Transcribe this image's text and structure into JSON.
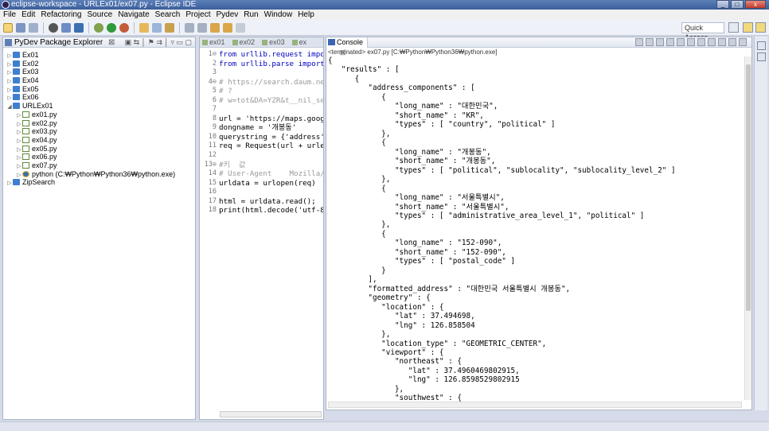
{
  "window": {
    "title": "eclipse-workspace - URLEx01/ex07.py - Eclipse IDE"
  },
  "menu": [
    "File",
    "Edit",
    "Refactoring",
    "Source",
    "Navigate",
    "Search",
    "Project",
    "Pydev",
    "Run",
    "Window",
    "Help"
  ],
  "toolbar": {
    "quick_access": "Quick Access"
  },
  "explorer": {
    "title": "PyDev Package Explorer",
    "items": [
      {
        "label": "Ex01",
        "kind": "project",
        "level": 0,
        "state": "collapsed"
      },
      {
        "label": "Ex02",
        "kind": "project",
        "level": 0,
        "state": "collapsed"
      },
      {
        "label": "Ex03",
        "kind": "project",
        "level": 0,
        "state": "collapsed"
      },
      {
        "label": "Ex04",
        "kind": "project",
        "level": 0,
        "state": "collapsed"
      },
      {
        "label": "Ex05",
        "kind": "project",
        "level": 0,
        "state": "collapsed"
      },
      {
        "label": "Ex06",
        "kind": "project",
        "level": 0,
        "state": "collapsed"
      },
      {
        "label": "URLEx01",
        "kind": "project",
        "level": 0,
        "state": "expanded"
      },
      {
        "label": "ex01.py",
        "kind": "file",
        "level": 1,
        "state": "collapsed"
      },
      {
        "label": "ex02.py",
        "kind": "file",
        "level": 1,
        "state": "collapsed"
      },
      {
        "label": "ex03.py",
        "kind": "file",
        "level": 1,
        "state": "collapsed"
      },
      {
        "label": "ex04.py",
        "kind": "file",
        "level": 1,
        "state": "collapsed"
      },
      {
        "label": "ex05.py",
        "kind": "file",
        "level": 1,
        "state": "collapsed"
      },
      {
        "label": "ex06.py",
        "kind": "file",
        "level": 1,
        "state": "collapsed"
      },
      {
        "label": "ex07.py",
        "kind": "file",
        "level": 1,
        "state": "collapsed"
      },
      {
        "label": "python  (C:₩Python₩Python36₩python.exe)",
        "kind": "python",
        "level": 1,
        "state": "collapsed"
      },
      {
        "label": "ZipSearch",
        "kind": "project",
        "level": 0,
        "state": "collapsed"
      }
    ]
  },
  "editor": {
    "tabs": [
      "ex01",
      "ex02",
      "ex03",
      "ex"
    ],
    "lines": [
      {
        "n": "1⊖",
        "t": "from urllib.request impo",
        "c": "kw"
      },
      {
        "n": "2",
        "t": "from urllib.parse import",
        "c": "kw"
      },
      {
        "n": "3",
        "t": "",
        "c": ""
      },
      {
        "n": "4⊖",
        "t": "# https://search.daum.ne",
        "c": "cm"
      },
      {
        "n": "5",
        "t": "# ?",
        "c": "cm"
      },
      {
        "n": "6",
        "t": "# w=tot&DA=YZR&t__nil_se",
        "c": "cm"
      },
      {
        "n": "7",
        "t": "",
        "c": ""
      },
      {
        "n": "8",
        "t": "url = 'https://maps.goog",
        "c": ""
      },
      {
        "n": "9",
        "t": "dongname = '개봉동'",
        "c": ""
      },
      {
        "n": "10",
        "t": "querystring = {'address'",
        "c": ""
      },
      {
        "n": "11",
        "t": "req = Request(url + urle",
        "c": ""
      },
      {
        "n": "12",
        "t": "",
        "c": ""
      },
      {
        "n": "13⊖",
        "t": "#키  값",
        "c": "cm"
      },
      {
        "n": "14",
        "t": "# User-Agent    Mozilla/",
        "c": "cm"
      },
      {
        "n": "15",
        "t": "urldata = urlopen(req)",
        "c": ""
      },
      {
        "n": "16",
        "t": "",
        "c": ""
      },
      {
        "n": "17",
        "t": "html = urldata.read();",
        "c": ""
      },
      {
        "n": "18",
        "t": "print(html.decode('utf-8",
        "c": ""
      }
    ]
  },
  "console": {
    "title": "Console",
    "status": "<terminated> ex07.py [C:₩Python₩Python36₩python.exe]",
    "lines": [
      "{",
      "   \"results\" : [",
      "      {",
      "         \"address_components\" : [",
      "            {",
      "               \"long_name\" : \"대한민국\",",
      "               \"short_name\" : \"KR\",",
      "               \"types\" : [ \"country\", \"political\" ]",
      "            },",
      "            {",
      "               \"long_name\" : \"개봉동\",",
      "               \"short_name\" : \"개봉동\",",
      "               \"types\" : [ \"political\", \"sublocality\", \"sublocality_level_2\" ]",
      "            },",
      "            {",
      "               \"long_name\" : \"서울특별시\",",
      "               \"short_name\" : \"서울특별시\",",
      "               \"types\" : [ \"administrative_area_level_1\", \"political\" ]",
      "            },",
      "            {",
      "               \"long_name\" : \"152-090\",",
      "               \"short_name\" : \"152-090\",",
      "               \"types\" : [ \"postal_code\" ]",
      "            }",
      "         ],",
      "         \"formatted_address\" : \"대한민국 서울특별시 개봉동\",",
      "         \"geometry\" : {",
      "            \"location\" : {",
      "               \"lat\" : 37.494698,",
      "               \"lng\" : 126.858504",
      "            },",
      "            \"location_type\" : \"GEOMETRIC_CENTER\",",
      "            \"viewport\" : {",
      "               \"northeast\" : {",
      "                  \"lat\" : 37.4960469802915,",
      "                  \"lng\" : 126.8598529802915",
      "               },",
      "               \"southwest\" : {"
    ]
  }
}
